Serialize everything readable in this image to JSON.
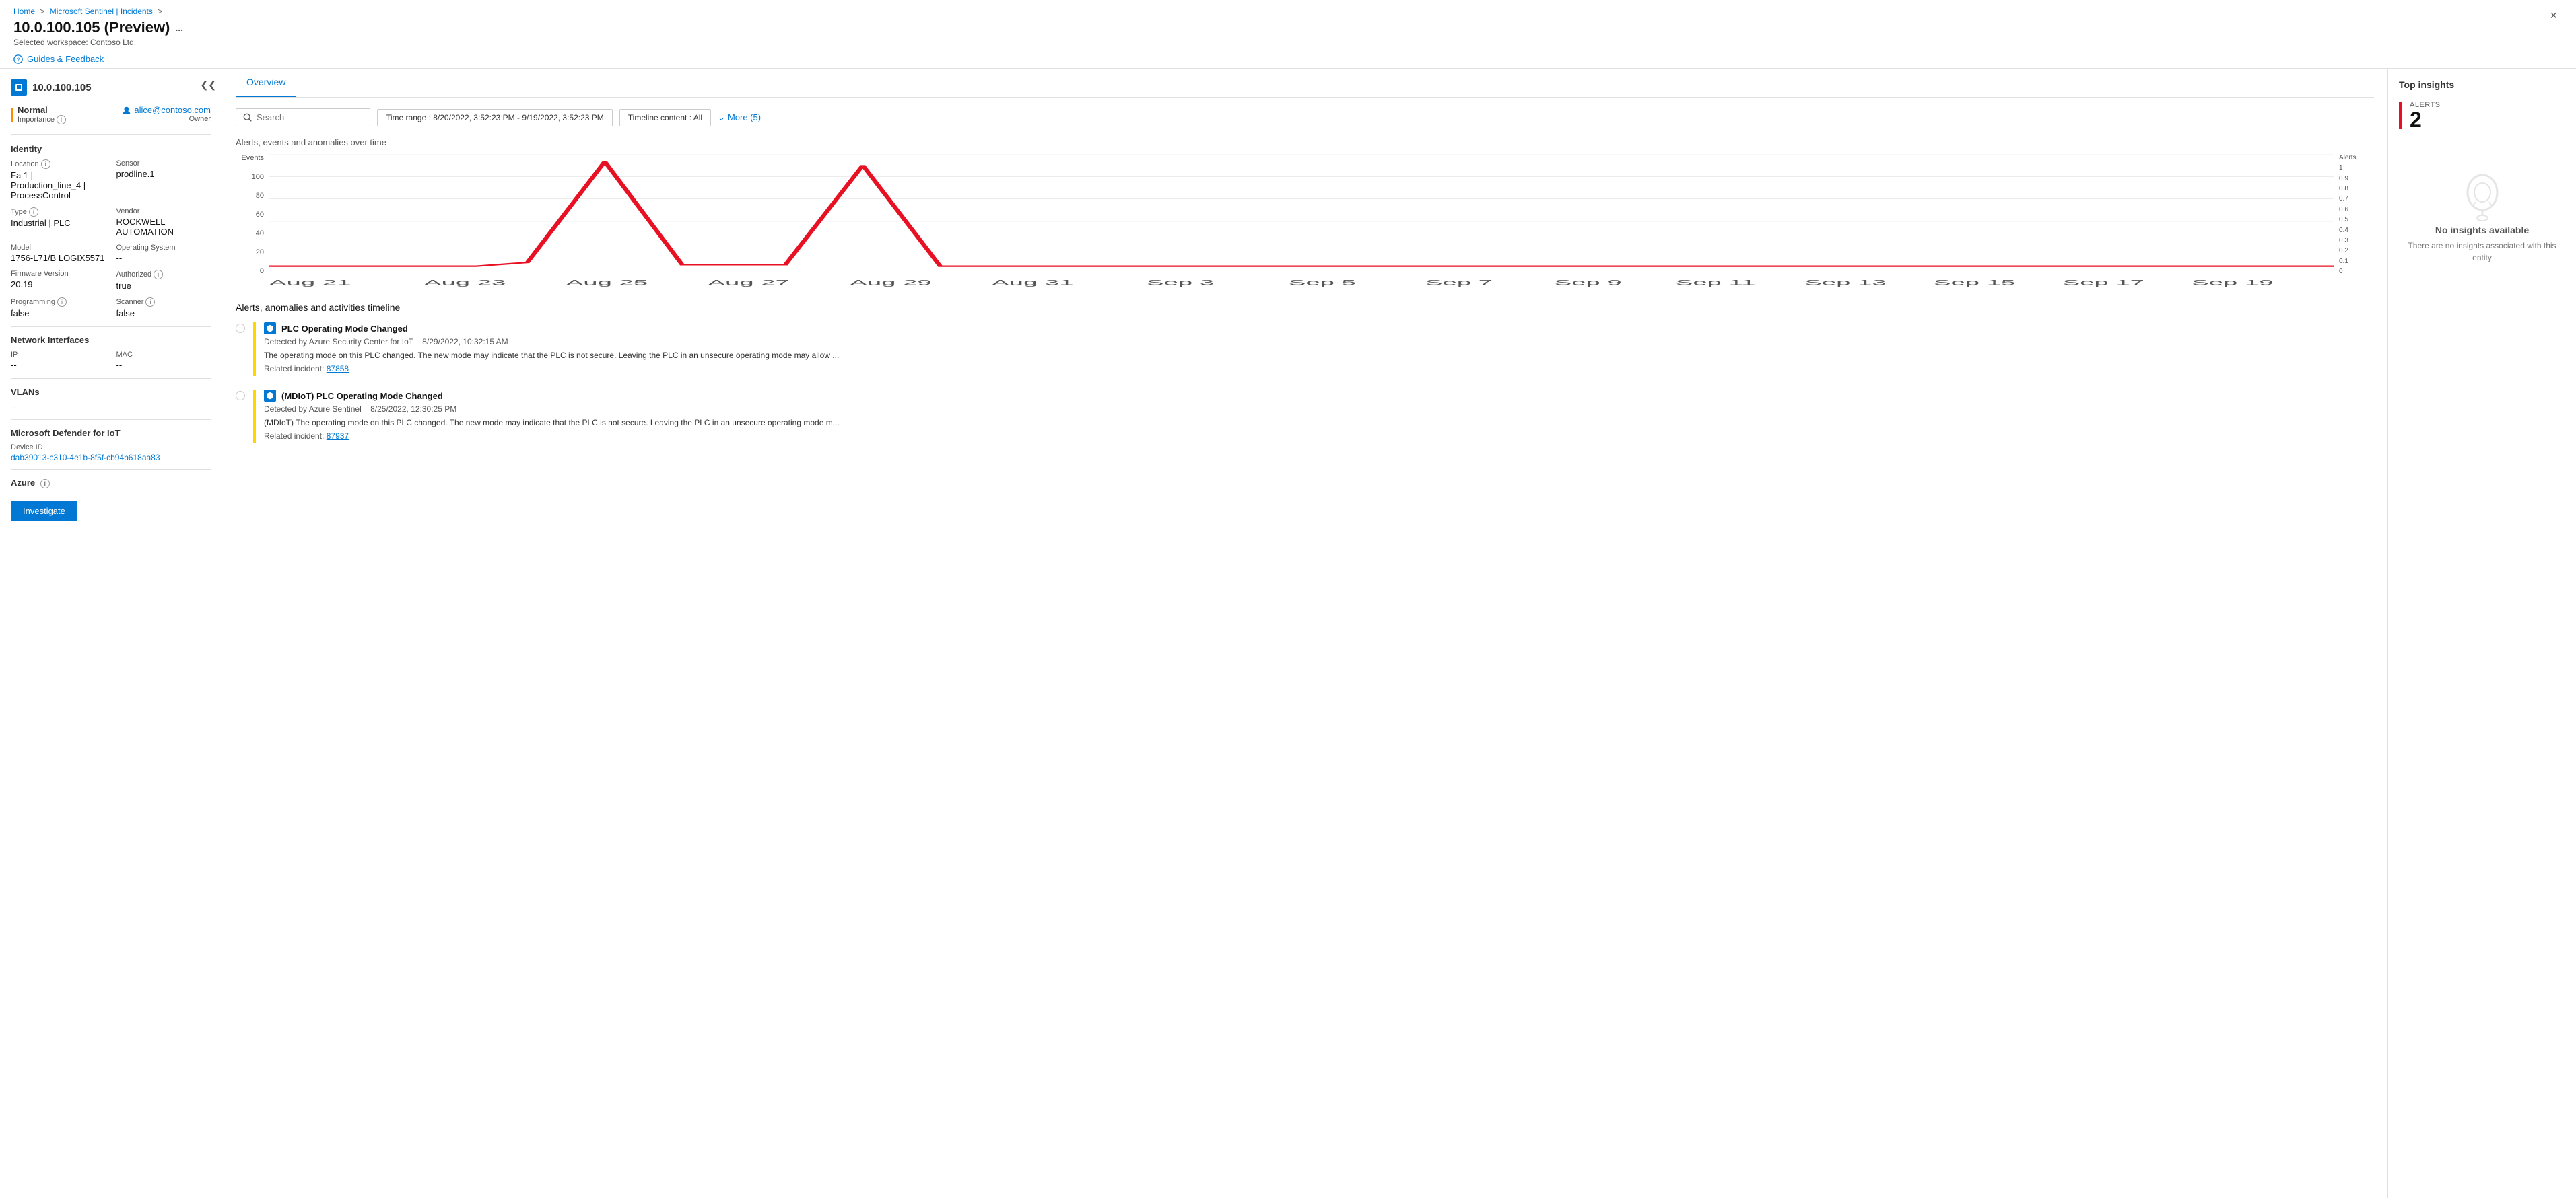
{
  "breadcrumb": {
    "home": "Home",
    "sentinel": "Microsoft Sentinel | Incidents",
    "separator": ">"
  },
  "page": {
    "title": "10.0.100.105 (Preview)",
    "more_icon": "...",
    "workspace_label": "Selected workspace: Contoso Ltd.",
    "guides_label": "Guides & Feedback",
    "close_label": "×"
  },
  "device": {
    "name": "10.0.100.105",
    "status": "Normal",
    "importance": "Importance",
    "owner_name": "alice@contoso.com",
    "owner_label": "Owner"
  },
  "identity": {
    "section_title": "Identity",
    "location_label": "Location",
    "location_value": "Fa 1 | Production_line_4 | ProcessControl",
    "sensor_label": "Sensor",
    "sensor_value": "prodline.1",
    "type_label": "Type",
    "type_value": "Industrial | PLC",
    "vendor_label": "Vendor",
    "vendor_value": "ROCKWELL AUTOMATION",
    "model_label": "Model",
    "model_value": "1756-L71/B LOGIX5571",
    "os_label": "Operating System",
    "os_value": "--",
    "firmware_label": "Firmware Version",
    "firmware_value": "20.19",
    "authorized_label": "Authorized",
    "authorized_value": "true",
    "programming_label": "Programming",
    "programming_value": "false",
    "scanner_label": "Scanner",
    "scanner_value": "false"
  },
  "network": {
    "section_title": "Network Interfaces",
    "ip_label": "IP",
    "ip_value": "--",
    "mac_label": "MAC",
    "mac_value": "--"
  },
  "vlans": {
    "section_title": "VLANs",
    "value": "--"
  },
  "defender": {
    "section_title": "Microsoft Defender for IoT",
    "device_id_label": "Device ID",
    "device_id_value": "dab39013-c310-4e1b-8f5f-cb94b618aa83"
  },
  "azure": {
    "section_title": "Azure"
  },
  "investigate_label": "Investigate",
  "tabs": [
    {
      "id": "overview",
      "label": "Overview",
      "active": true
    }
  ],
  "filters": {
    "search_placeholder": "Search",
    "time_range_label": "Time range : 8/20/2022, 3:52:23 PM - 9/19/2022, 3:52:23 PM",
    "timeline_content_label": "Timeline content : All",
    "more_label": "More (5)"
  },
  "chart": {
    "title": "Alerts, events and anomalies over time",
    "events_label": "Events",
    "alerts_label": "Alerts",
    "y_events": [
      0,
      20,
      40,
      60,
      80,
      100
    ],
    "y_alerts": [
      0,
      0.1,
      0.2,
      0.3,
      0.4,
      0.5,
      0.6,
      0.7,
      0.8,
      0.9,
      1
    ],
    "x_labels": [
      "Aug 21",
      "Aug 23",
      "Aug 25",
      "Aug 27",
      "Aug 29",
      "Aug 31",
      "Sep 3",
      "Sep 5",
      "Sep 7",
      "Sep 9",
      "Sep 11",
      "Sep 13",
      "Sep 15",
      "Sep 17",
      "Sep 19"
    ]
  },
  "timeline": {
    "title": "Alerts, anomalies and activities timeline",
    "items": [
      {
        "id": 1,
        "event_title": "PLC Operating Mode Changed",
        "detected_by": "Detected by Azure Security Center for IoT",
        "date": "8/29/2022, 10:32:15 AM",
        "description": "The operating mode on this PLC changed. The new mode may indicate that the PLC is not secure. Leaving the PLC in an unsecure operating mode may allow ...",
        "related_incident_label": "Related incident:",
        "related_incident_id": "87858",
        "related_incident_link": "#87858"
      },
      {
        "id": 2,
        "event_title": "(MDIoT) PLC Operating Mode Changed",
        "detected_by": "Detected by Azure Sentinel",
        "date": "8/25/2022, 12:30:25 PM",
        "description": "(MDIoT) The operating mode on this PLC changed. The new mode may indicate that the PLC is not secure. Leaving the PLC in an unsecure operating mode m...",
        "related_incident_label": "Related incident:",
        "related_incident_id": "87937",
        "related_incident_link": "#87937"
      }
    ]
  },
  "insights": {
    "title": "Top insights",
    "alerts_label": "ALERTS",
    "alerts_count": "2",
    "no_insights_title": "No insights available",
    "no_insights_desc": "There are no insights associated with this entity"
  }
}
